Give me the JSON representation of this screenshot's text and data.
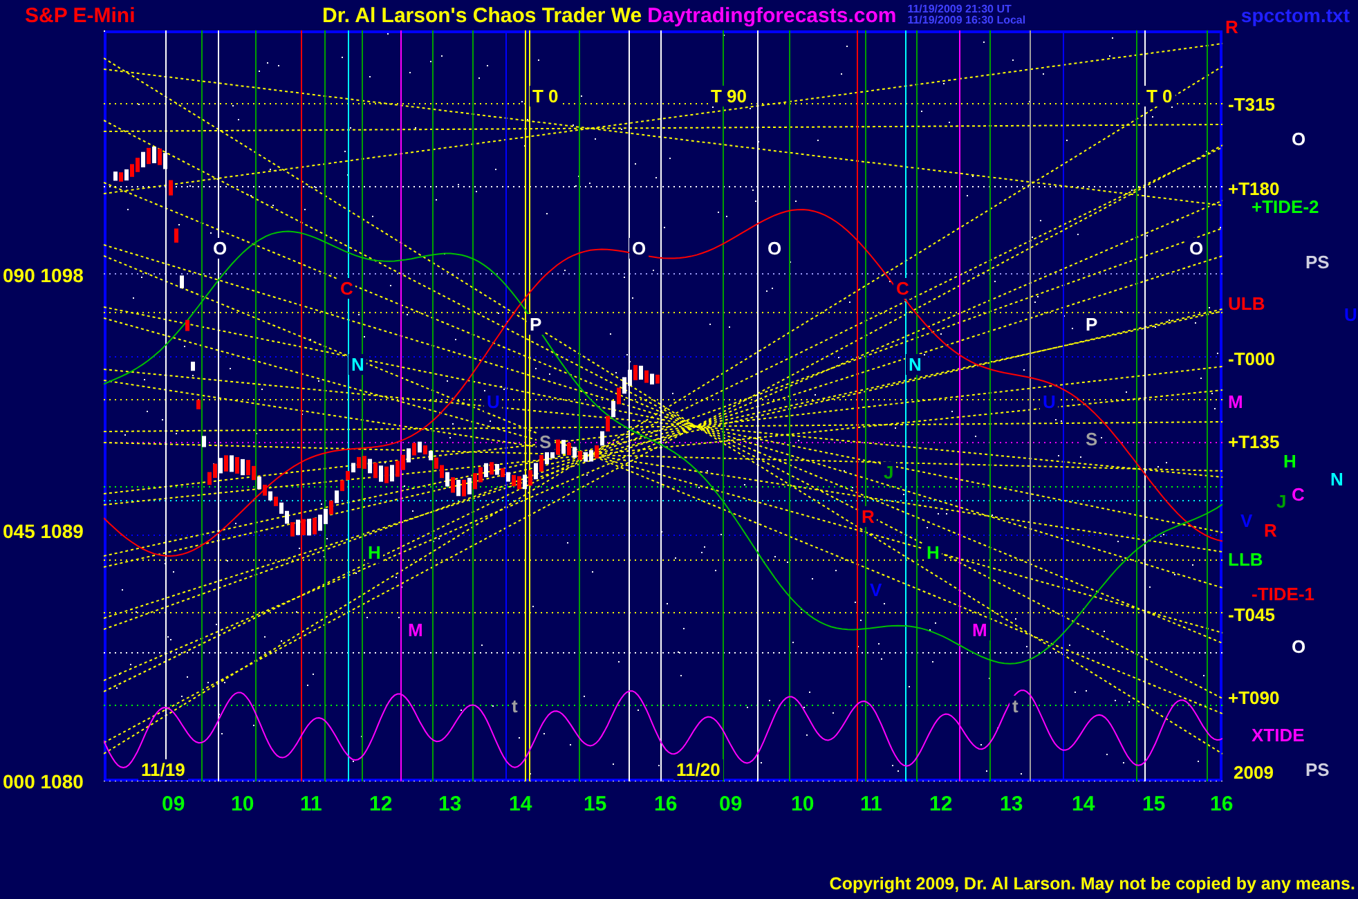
{
  "header": {
    "symbol": "S&P E-Mini",
    "title": "Dr. Al Larson's Chaos Trader We",
    "site": "Daytradingforecasts.com",
    "timestamps": [
      "11/19/2009 21:30 UT",
      "11/19/2009 16:30 Local"
    ],
    "file": "spcctom.txt"
  },
  "price_axis": [
    "090 1098",
    "045 1089",
    "000 1080"
  ],
  "plot_labels": [
    {
      "text": "T  0",
      "color": "#ffff00"
    },
    {
      "text": "T  90",
      "color": "#ffff00"
    },
    {
      "text": "T  0",
      "color": "#ffff00"
    },
    {
      "text": "O",
      "color": "#ffffff"
    },
    {
      "text": "O",
      "color": "#ffffff"
    },
    {
      "text": "O",
      "color": "#ffffff"
    },
    {
      "text": "O",
      "color": "#ffffff"
    },
    {
      "text": "C",
      "color": "#ff0000"
    },
    {
      "text": "C",
      "color": "#ff0000"
    },
    {
      "text": "P",
      "color": "#ffffff"
    },
    {
      "text": "P",
      "color": "#ffffff"
    },
    {
      "text": "N",
      "color": "#00ffff"
    },
    {
      "text": "N",
      "color": "#00ffff"
    },
    {
      "text": "U",
      "color": "#0000ff"
    },
    {
      "text": "U",
      "color": "#0000ff"
    },
    {
      "text": "S",
      "color": "#a0a0a0"
    },
    {
      "text": "S",
      "color": "#a0a0a0"
    },
    {
      "text": "J",
      "color": "#00a000"
    },
    {
      "text": "R",
      "color": "#ff0000"
    },
    {
      "text": "H",
      "color": "#00ff00"
    },
    {
      "text": "H",
      "color": "#00ff00"
    },
    {
      "text": "V",
      "color": "#0000ff"
    },
    {
      "text": "M",
      "color": "#ff00ff"
    },
    {
      "text": "M",
      "color": "#ff00ff"
    },
    {
      "text": "t",
      "color": "#a0a0a0"
    },
    {
      "text": "t",
      "color": "#a0a0a0"
    },
    {
      "text": "11/19",
      "color": "#ffff00"
    },
    {
      "text": "11/20",
      "color": "#ffff00"
    }
  ],
  "right_labels": [
    {
      "text": "R",
      "color": "#ff0000"
    },
    {
      "text": "-T315",
      "color": "#ffff00"
    },
    {
      "text": "O",
      "color": "#ffffff"
    },
    {
      "text": "+T180",
      "color": "#ffff00"
    },
    {
      "text": "+TIDE-2",
      "color": "#00ff00"
    },
    {
      "text": "PS",
      "color": "#d0d0e0"
    },
    {
      "text": "ULB",
      "color": "#ff0000"
    },
    {
      "text": "U",
      "color": "#0000ff"
    },
    {
      "text": "-T000",
      "color": "#ffff00"
    },
    {
      "text": "M",
      "color": "#ff00ff"
    },
    {
      "text": "+T135",
      "color": "#ffff00"
    },
    {
      "text": "H",
      "color": "#00ff00"
    },
    {
      "text": "N",
      "color": "#00ffff"
    },
    {
      "text": "C",
      "color": "#ff00ff"
    },
    {
      "text": "J",
      "color": "#00a000"
    },
    {
      "text": "V",
      "color": "#0000ff"
    },
    {
      "text": "R",
      "color": "#ff0000"
    },
    {
      "text": "LLB",
      "color": "#00ff00"
    },
    {
      "text": "-TIDE-1",
      "color": "#ff0000"
    },
    {
      "text": "-T045",
      "color": "#ffff00"
    },
    {
      "text": "O",
      "color": "#ffffff"
    },
    {
      "text": "+T090",
      "color": "#ffff00"
    },
    {
      "text": "XTIDE",
      "color": "#ff00ff"
    },
    {
      "text": "2009",
      "color": "#ffff00"
    },
    {
      "text": "PS",
      "color": "#d0d0e0"
    }
  ],
  "hour_labels": [
    "09",
    "10",
    "11",
    "12",
    "13",
    "14",
    "15",
    "16",
    "09",
    "10",
    "11",
    "12",
    "13",
    "14",
    "15",
    "16"
  ],
  "footer": "Copyright 2009, Dr. Al Larson. May not be copied by any means."
}
